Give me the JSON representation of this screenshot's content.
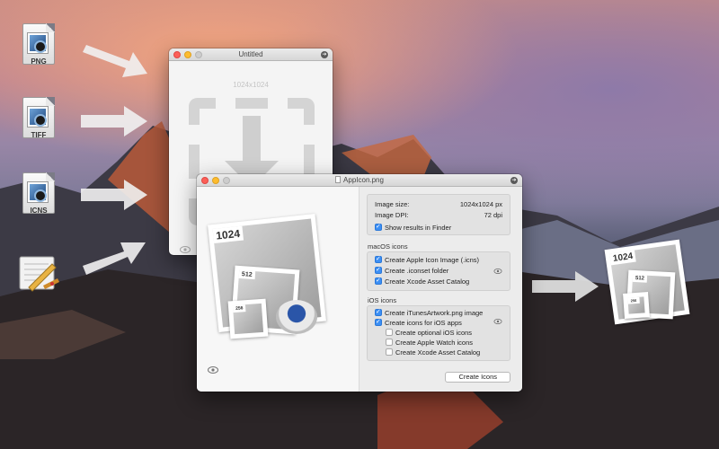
{
  "files": [
    {
      "label": "PNG"
    },
    {
      "label": "TIFF"
    },
    {
      "label": "ICNS"
    }
  ],
  "untitled_window": {
    "title": "Untitled",
    "size_hint": "1024x1024"
  },
  "main_window": {
    "title": "AppIcon.png",
    "preview_labels": {
      "big": "1024",
      "mid": "512",
      "small": "256"
    },
    "image_size_label": "Image size:",
    "image_size_value": "1024x1024 px",
    "image_dpi_label": "Image DPI:",
    "image_dpi_value": "72 dpi",
    "show_results": "Show results in Finder",
    "macos_title": "macOS icons",
    "macos_items": [
      "Create Apple Icon Image (.icns)",
      "Create .iconset folder",
      "Create Xcode Asset Catalog"
    ],
    "ios_title": "iOS icons",
    "ios_items": [
      "Create iTunesArtwork.png image",
      "Create icons for iOS apps",
      "Create optional iOS icons",
      "Create Apple Watch icons",
      "Create Xcode Asset Catalog"
    ],
    "create_button": "Create Icons"
  },
  "result_preview": {
    "big": "1024",
    "mid": "512",
    "small": "256"
  }
}
